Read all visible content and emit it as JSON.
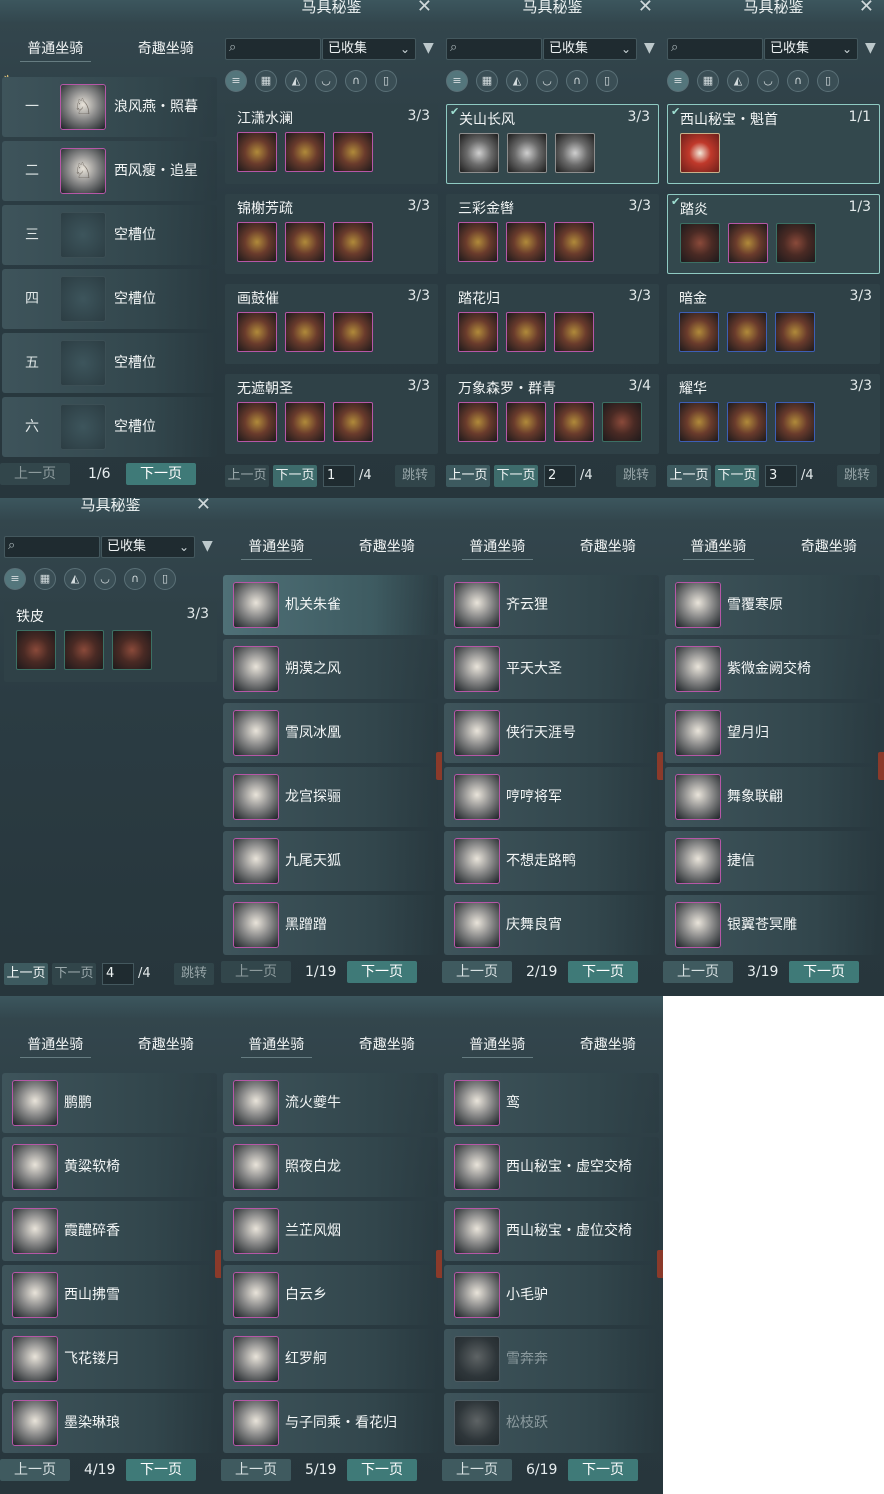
{
  "common": {
    "tab_normal": "普通坐骑",
    "tab_fun": "奇趣坐骑",
    "prev": "上一页",
    "next": "下一页",
    "codex_title": "马具秘鉴",
    "filter_value": "已收集",
    "jump": "跳转"
  },
  "slots_panel": {
    "page": "1/6",
    "rows": [
      {
        "num": "一",
        "name": "浪风燕・照暮"
      },
      {
        "num": "二",
        "name": "西风瘦・追星"
      },
      {
        "num": "三",
        "name": "空槽位"
      },
      {
        "num": "四",
        "name": "空槽位"
      },
      {
        "num": "五",
        "name": "空槽位"
      },
      {
        "num": "六",
        "name": "空槽位"
      }
    ]
  },
  "codex_panels": [
    {
      "page_input": "1",
      "page_total": "/4",
      "sets": [
        {
          "name": "江潇水澜",
          "count": "3/3"
        },
        {
          "name": "锦榭芳疏",
          "count": "3/3"
        },
        {
          "name": "画鼓催",
          "count": "3/3"
        },
        {
          "name": "无遮朝圣",
          "count": "3/3"
        }
      ]
    },
    {
      "page_input": "2",
      "page_total": "/4",
      "sets": [
        {
          "name": "关山长风",
          "count": "3/3"
        },
        {
          "name": "三彩金辔",
          "count": "3/3"
        },
        {
          "name": "踏花归",
          "count": "3/3"
        },
        {
          "name": "万象森罗・群青",
          "count": "3/4"
        }
      ]
    },
    {
      "page_input": "3",
      "page_total": "/4",
      "sets": [
        {
          "name": "西山秘宝・魁首",
          "count": "1/1"
        },
        {
          "name": "踏炎",
          "count": "1/3"
        },
        {
          "name": "暗金",
          "count": "3/3"
        },
        {
          "name": "耀华",
          "count": "3/3"
        }
      ]
    },
    {
      "page_input": "4",
      "page_total": "/4",
      "sets": [
        {
          "name": "铁皮",
          "count": "3/3"
        }
      ]
    }
  ],
  "mount_pages": [
    {
      "page": "1/19",
      "names": [
        "机关朱雀",
        "朔漠之风",
        "雪凤冰凰",
        "龙宫探骊",
        "九尾天狐",
        "黑蹭蹭"
      ]
    },
    {
      "page": "2/19",
      "names": [
        "齐云狸",
        "平天大圣",
        "侠行天涯号",
        "哼哼将军",
        "不想走路鸭",
        "庆舞良宵"
      ]
    },
    {
      "page": "3/19",
      "names": [
        "雪覆寒原",
        "紫微金阙交椅",
        "望月归",
        "舞象联翩",
        "捷信",
        "银翼苍冥雕"
      ]
    },
    {
      "page": "4/19",
      "names": [
        "鹏鹏",
        "黄粱软椅",
        "霞醴碎香",
        "西山拂雪",
        "飞花镂月",
        "墨染琳琅"
      ]
    },
    {
      "page": "5/19",
      "names": [
        "流火夔牛",
        "照夜白龙",
        "兰芷风烟",
        "白云乡",
        "红罗舸",
        "与子同乘・看花归"
      ]
    },
    {
      "page": "6/19",
      "names": [
        "鸾",
        "西山秘宝・虚空交椅",
        "西山秘宝・虚位交椅",
        "小毛驴",
        "雪奔奔",
        "松枝跃"
      ]
    }
  ]
}
